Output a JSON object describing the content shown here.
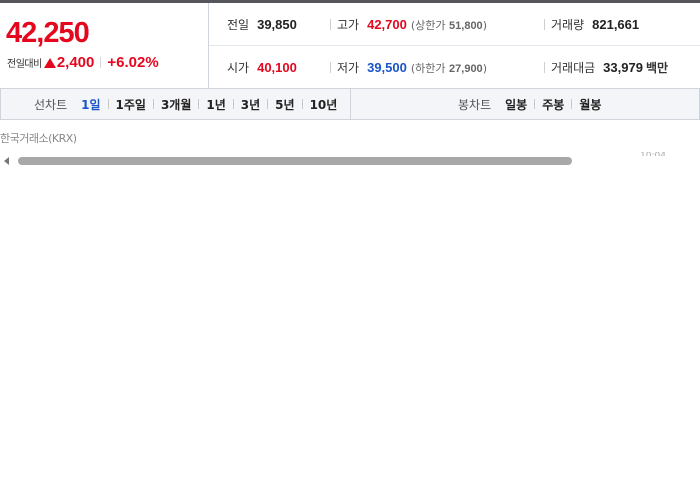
{
  "price": {
    "current": "42,250",
    "diff_label": "전일대비",
    "diff_value": "2,400",
    "diff_rate": "+6.02%"
  },
  "info": {
    "prev_close": {
      "label": "전일",
      "value": "39,850"
    },
    "high": {
      "label": "고가",
      "value": "42,700",
      "limit_label": "상한가",
      "limit_value": "51,800"
    },
    "volume": {
      "label": "거래량",
      "value": "821,661"
    },
    "open": {
      "label": "시가",
      "value": "40,100"
    },
    "low": {
      "label": "저가",
      "value": "39,500",
      "limit_label": "하한가",
      "limit_value": "27,900"
    },
    "amount": {
      "label": "거래대금",
      "value": "33,979",
      "unit": "백만"
    }
  },
  "line_tabs": {
    "label": "선차트",
    "items": [
      "1일",
      "1주일",
      "3개월",
      "1년",
      "3년",
      "5년",
      "10년"
    ],
    "active": "1일"
  },
  "candle_tabs": {
    "label": "봉차트",
    "items": [
      "일봉",
      "주봉",
      "월봉"
    ]
  },
  "source": "한국거래소(KRX)",
  "clipped_text": "10:04",
  "colors": {
    "up": "#e4071e",
    "down": "#1a55c8",
    "active_tab": "#1a55c8"
  }
}
